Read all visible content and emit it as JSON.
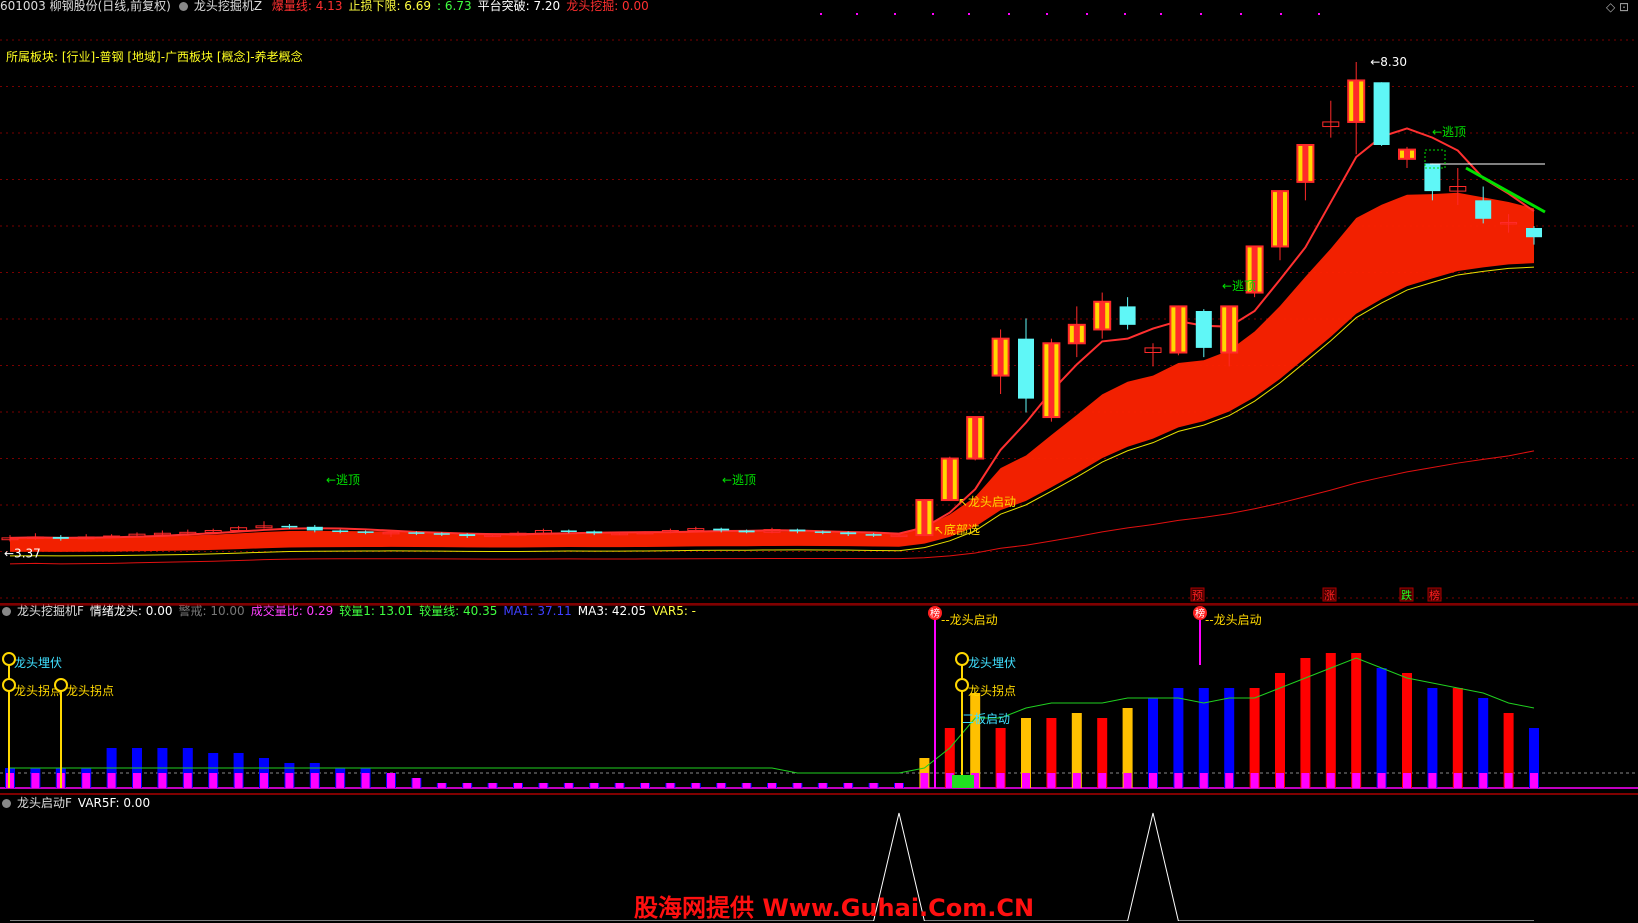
{
  "colors": {
    "up": "#ff2a2a",
    "down": "#5ff7f7",
    "yellow": "#ffd800",
    "green": "#00e000",
    "blue": "#0000ff",
    "magenta": "#ff00ff",
    "gridred": "#7a0000"
  },
  "main_header": {
    "stock": "601003 柳钢股份(日线,前复权)",
    "indicator": "龙头挖掘机Z",
    "items": [
      {
        "text": "爆量线: 4.13",
        "color": "#ff3030"
      },
      {
        "text": "止损下限: 6.69",
        "color": "#ffff40"
      },
      {
        "text": ": 6.73",
        "color": "#40ff40"
      },
      {
        "text": "平台突破: 7.20",
        "color": "#ffffff"
      },
      {
        "text": "龙头挖掘: 0.00",
        "color": "#ff3030"
      }
    ],
    "sector": "所属板块: [行业]-普钢 [地域]-广西板块 [概念]-养老概念"
  },
  "chart_data": [
    {
      "type": "candlestick",
      "high_label": "8.30",
      "low_label": "3.37",
      "annotations": [
        "←逃顶",
        "←逃顶",
        "←逃顶",
        "←逃顶",
        "龙头启动",
        "底部选",
        "预",
        "涨",
        "跌",
        "榜"
      ],
      "candles": [
        [
          3.42,
          3.44,
          3.47,
          3.4
        ],
        [
          3.44,
          3.45,
          3.49,
          3.42
        ],
        [
          3.45,
          3.43,
          3.47,
          3.41
        ],
        [
          3.43,
          3.45,
          3.48,
          3.42
        ],
        [
          3.45,
          3.46,
          3.48,
          3.44
        ],
        [
          3.46,
          3.48,
          3.5,
          3.45
        ],
        [
          3.48,
          3.49,
          3.52,
          3.47
        ],
        [
          3.49,
          3.5,
          3.53,
          3.48
        ],
        [
          3.5,
          3.52,
          3.54,
          3.49
        ],
        [
          3.52,
          3.55,
          3.57,
          3.51
        ],
        [
          3.55,
          3.57,
          3.62,
          3.54
        ],
        [
          3.57,
          3.56,
          3.59,
          3.54
        ],
        [
          3.56,
          3.52,
          3.58,
          3.5
        ],
        [
          3.52,
          3.51,
          3.53,
          3.49
        ],
        [
          3.51,
          3.5,
          3.52,
          3.48
        ],
        [
          3.5,
          3.5,
          3.52,
          3.45
        ],
        [
          3.5,
          3.49,
          3.51,
          3.47
        ],
        [
          3.49,
          3.48,
          3.5,
          3.46
        ],
        [
          3.48,
          3.46,
          3.49,
          3.44
        ],
        [
          3.46,
          3.47,
          3.49,
          3.45
        ],
        [
          3.47,
          3.49,
          3.51,
          3.46
        ],
        [
          3.49,
          3.52,
          3.54,
          3.48
        ],
        [
          3.52,
          3.51,
          3.53,
          3.49
        ],
        [
          3.51,
          3.49,
          3.52,
          3.47
        ],
        [
          3.49,
          3.49,
          3.5,
          3.47
        ],
        [
          3.49,
          3.5,
          3.51,
          3.48
        ],
        [
          3.5,
          3.52,
          3.54,
          3.49
        ],
        [
          3.52,
          3.54,
          3.56,
          3.51
        ],
        [
          3.54,
          3.52,
          3.55,
          3.5
        ],
        [
          3.52,
          3.5,
          3.53,
          3.49
        ],
        [
          3.5,
          3.53,
          3.55,
          3.49
        ],
        [
          3.53,
          3.51,
          3.54,
          3.49
        ],
        [
          3.51,
          3.5,
          3.52,
          3.48
        ],
        [
          3.5,
          3.48,
          3.51,
          3.46
        ],
        [
          3.48,
          3.47,
          3.49,
          3.45
        ],
        [
          3.47,
          3.47,
          3.49,
          3.46
        ],
        [
          3.47,
          3.85,
          3.86,
          3.46
        ],
        [
          3.85,
          4.3,
          4.32,
          3.84
        ],
        [
          4.3,
          4.75,
          4.76,
          4.28
        ],
        [
          5.2,
          5.6,
          5.7,
          5.0
        ],
        [
          5.6,
          4.95,
          5.82,
          4.8
        ],
        [
          4.75,
          5.55,
          5.6,
          4.7
        ],
        [
          5.55,
          5.75,
          5.95,
          5.4
        ],
        [
          5.7,
          6.0,
          6.1,
          5.6
        ],
        [
          5.95,
          5.75,
          6.05,
          5.7
        ],
        [
          5.45,
          5.5,
          5.55,
          5.3
        ],
        [
          5.45,
          5.95,
          5.96,
          5.42
        ],
        [
          5.9,
          5.5,
          5.92,
          5.4
        ],
        [
          5.45,
          5.95,
          5.96,
          5.3
        ],
        [
          6.1,
          6.6,
          6.61,
          6.05
        ],
        [
          6.6,
          7.2,
          7.21,
          6.45
        ],
        [
          7.3,
          7.7,
          7.71,
          7.1
        ],
        [
          7.9,
          7.95,
          8.18,
          7.78
        ],
        [
          7.95,
          8.4,
          8.6,
          7.6
        ],
        [
          8.38,
          7.7,
          8.38,
          7.69
        ],
        [
          7.55,
          7.65,
          7.68,
          7.45
        ],
        [
          7.5,
          7.2,
          7.5,
          7.1
        ],
        [
          7.2,
          7.25,
          7.45,
          7.05
        ],
        [
          7.1,
          6.9,
          7.25,
          6.85
        ],
        [
          6.86,
          6.86,
          6.95,
          6.75
        ],
        [
          6.8,
          6.7,
          6.82,
          6.62
        ]
      ]
    },
    {
      "type": "bar",
      "series": [
        {
          "name": "情绪龙头",
          "values": [
            1,
            1,
            0.5,
            0.5,
            0.5,
            0.5,
            0.5,
            0.5,
            0.5,
            0.5,
            0.5,
            0.5,
            0.5,
            0.5,
            0.5,
            0.5,
            0.5,
            0.5,
            0.5,
            0.5,
            0.5,
            0.5,
            0.5,
            0.5,
            0.5,
            0.5,
            0.5,
            0.5,
            0.5,
            0.5,
            0.5,
            0.5,
            0.5,
            0.5,
            0.5,
            0.5,
            3,
            6,
            6,
            6,
            6,
            6,
            6,
            6,
            6,
            6,
            6,
            7,
            7,
            7,
            7,
            7,
            7,
            7,
            7,
            7,
            7,
            7,
            7,
            7,
            7
          ]
        }
      ],
      "header": [
        {
          "text": "龙头挖掘机F",
          "color": "#dddddd"
        },
        {
          "text": "情绪龙头: 0.00",
          "color": "#ffffff"
        },
        {
          "text": "警戒: 10.00",
          "color": "#777777"
        },
        {
          "text": "成交量比: 0.29",
          "color": "#ff40ff"
        },
        {
          "text": "较量1: 13.01",
          "color": "#40ff40"
        },
        {
          "text": "较量线: 40.35",
          "color": "#40ff40"
        },
        {
          "text": "MA1: 37.11",
          "color": "#4040ff"
        },
        {
          "text": "MA3: 42.05",
          "color": "#ffffff"
        },
        {
          "text": "VAR5: -",
          "color": "#ffff40"
        }
      ],
      "labels": [
        "龙头埋伏",
        "龙头拐点",
        "龙头拐点",
        "龙头启动",
        "龙头埋伏",
        "龙头拐点",
        "二板启动",
        "龙头启动"
      ],
      "circle_labels": [
        "榜",
        "榜"
      ],
      "volume": [
        4,
        4,
        4,
        4,
        8,
        8,
        8,
        8,
        7,
        7,
        6,
        5,
        5,
        4,
        4,
        3,
        2,
        1,
        1,
        1,
        1,
        1,
        1,
        1,
        1,
        1,
        1,
        1,
        1,
        1,
        1,
        1,
        1,
        1,
        1,
        1,
        6,
        12,
        19,
        12,
        14,
        14,
        15,
        14,
        16,
        18,
        20,
        20,
        20,
        20,
        23,
        26,
        27,
        27,
        24,
        23,
        20,
        20,
        18,
        15,
        12
      ],
      "green_line": [
        4,
        4,
        4,
        4,
        4,
        4,
        4,
        4,
        4,
        4,
        4,
        4,
        4,
        4,
        4,
        4,
        4,
        4,
        4,
        4,
        4,
        4,
        4,
        4,
        4,
        4,
        4,
        4,
        4,
        4,
        4,
        3,
        3,
        3,
        3,
        3,
        4,
        8,
        14,
        14,
        16,
        17,
        17,
        17,
        18,
        18,
        18,
        17,
        18,
        18,
        20,
        22,
        24,
        26,
        24,
        22,
        21,
        20,
        19,
        17,
        16
      ]
    },
    {
      "type": "line",
      "header": [
        {
          "text": "龙头启动F",
          "color": "#dddddd"
        },
        {
          "text": "VAR5F: 0.00",
          "color": "#ffffff"
        }
      ],
      "values": [
        0,
        0,
        0,
        0,
        0,
        0,
        0,
        0,
        0,
        0,
        0,
        0,
        0,
        0,
        0,
        0,
        0,
        0,
        0,
        0,
        0,
        0,
        0,
        0,
        0,
        0,
        0,
        0,
        0,
        0,
        0,
        0,
        0,
        0,
        0,
        1,
        0,
        0,
        0,
        0,
        0,
        0,
        0,
        0,
        0,
        1,
        0,
        0,
        0,
        0,
        0,
        0,
        0,
        0,
        0,
        0,
        0,
        0,
        0,
        0,
        0
      ]
    }
  ],
  "watermark": "股海网提供 Www.Guhai.Com.CN"
}
